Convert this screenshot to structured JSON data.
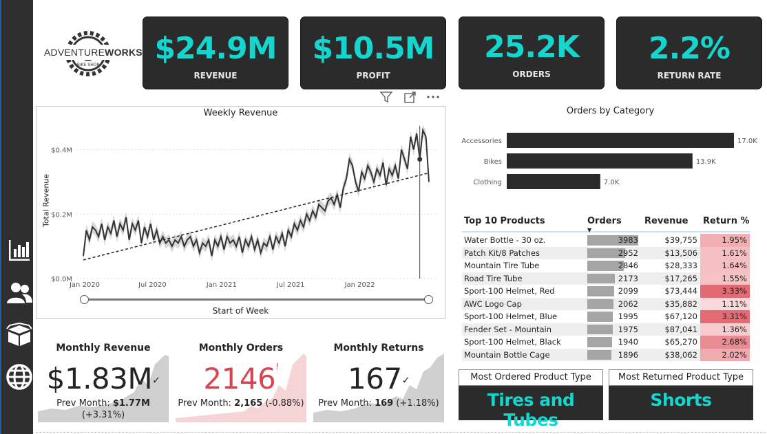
{
  "brand": {
    "logo_part1": "ADVENTURE",
    "logo_part2": "WORKS",
    "logo_sub": "BIKE SHOP"
  },
  "kpis": [
    {
      "value": "$24.9M",
      "label": "REVENUE"
    },
    {
      "value": "$10.5M",
      "label": "PROFIT"
    },
    {
      "value": "25.2K",
      "label": "ORDERS"
    },
    {
      "value": "2.2%",
      "label": "RETURN RATE"
    }
  ],
  "sidebar": {
    "icons": [
      "bar-chart-icon",
      "users-icon",
      "box-icon",
      "globe-icon"
    ]
  },
  "weekly_revenue": {
    "title": "Weekly Revenue",
    "xlabel": "Start of Week",
    "ylabel": "Total Revenue",
    "y_ticks": [
      "$0.0M",
      "$0.2M",
      "$0.4M"
    ],
    "x_ticks": [
      "Jan 2020",
      "Jul 2020",
      "Jan 2021",
      "Jul 2021",
      "Jan 2022"
    ]
  },
  "orders_by_category": {
    "title": "Orders by Category"
  },
  "top10": {
    "headers": {
      "product": "Top 10 Products",
      "orders": "Orders",
      "revenue": "Revenue",
      "return": "Return %"
    },
    "rows": [
      {
        "name": "Water Bottle - 30 oz.",
        "orders": "3983",
        "revenue": "$39,755",
        "return": "1.95%",
        "orders_val": 3983,
        "return_val": 1.95
      },
      {
        "name": "Patch Kit/8 Patches",
        "orders": "2952",
        "revenue": "$13,506",
        "return": "1.61%",
        "orders_val": 2952,
        "return_val": 1.61
      },
      {
        "name": "Mountain Tire Tube",
        "orders": "2846",
        "revenue": "$28,333",
        "return": "1.64%",
        "orders_val": 2846,
        "return_val": 1.64
      },
      {
        "name": "Road Tire Tube",
        "orders": "2173",
        "revenue": "$17,265",
        "return": "1.55%",
        "orders_val": 2173,
        "return_val": 1.55
      },
      {
        "name": "Sport-100 Helmet, Red",
        "orders": "2099",
        "revenue": "$73,444",
        "return": "3.33%",
        "orders_val": 2099,
        "return_val": 3.33
      },
      {
        "name": "AWC Logo Cap",
        "orders": "2062",
        "revenue": "$35,882",
        "return": "1.11%",
        "orders_val": 2062,
        "return_val": 1.11
      },
      {
        "name": "Sport-100 Helmet, Blue",
        "orders": "1995",
        "revenue": "$67,120",
        "return": "3.31%",
        "orders_val": 1995,
        "return_val": 3.31
      },
      {
        "name": "Fender Set - Mountain",
        "orders": "1975",
        "revenue": "$87,041",
        "return": "1.36%",
        "orders_val": 1975,
        "return_val": 1.36
      },
      {
        "name": "Sport-100 Helmet, Black",
        "orders": "1940",
        "revenue": "$65,270",
        "return": "2.68%",
        "orders_val": 1940,
        "return_val": 2.68
      },
      {
        "name": "Mountain Bottle Cage",
        "orders": "1896",
        "revenue": "$38,062",
        "return": "2.02%",
        "orders_val": 1896,
        "return_val": 2.02
      }
    ]
  },
  "product_types": [
    {
      "label": "Most Ordered Product Type",
      "value": "Tires and Tubes"
    },
    {
      "label": "Most Returned Product Type",
      "value": "Shorts"
    }
  ],
  "monthly": [
    {
      "title": "Monthly Revenue",
      "value": "$1.83M",
      "indicator": "✓",
      "prev_label": "Prev Month: ",
      "prev_value": "$1.77M",
      "prev_change": "(+3.31%)"
    },
    {
      "title": "Monthly Orders",
      "value": "2146",
      "indicator": "!",
      "prev_label": "Prev Month: ",
      "prev_value": "2,165",
      "prev_change": "(-0.88%)"
    },
    {
      "title": "Monthly Returns",
      "value": "167",
      "indicator": "✓",
      "prev_label": "Prev Month: ",
      "prev_value": "169",
      "prev_change": "(+1.18%)"
    }
  ],
  "colors": {
    "accent": "#14d6cf",
    "card_bg": "#2b2b2b",
    "bar": "#2b2b2b",
    "negative": "#d64550"
  },
  "chart_data": [
    {
      "type": "line",
      "title": "Weekly Revenue",
      "xlabel": "Start of Week",
      "ylabel": "Total Revenue",
      "ylim": [
        0,
        0.48
      ],
      "x_range": [
        "2020-01",
        "2022-06"
      ],
      "trendline": true,
      "series": [
        {
          "values": [
            0.07,
            0.15,
            0.12,
            0.16,
            0.15,
            0.13,
            0.17,
            0.12,
            0.16,
            0.14,
            0.18,
            0.13,
            0.17,
            0.15,
            0.19,
            0.12,
            0.17,
            0.15,
            0.18,
            0.11,
            0.16,
            0.13,
            0.17,
            0.12,
            0.15,
            0.11,
            0.13,
            0.11,
            0.12,
            0.1,
            0.12,
            0.11,
            0.13,
            0.1,
            0.12,
            0.13,
            0.1,
            0.12,
            0.08,
            0.11,
            0.1,
            0.12,
            0.07,
            0.12,
            0.1,
            0.13,
            0.09,
            0.13,
            0.11,
            0.12,
            0.1,
            0.13,
            0.08,
            0.12,
            0.1,
            0.13,
            0.09,
            0.12,
            0.08,
            0.11,
            0.1,
            0.13,
            0.09,
            0.13,
            0.11,
            0.14,
            0.1,
            0.15,
            0.13,
            0.17,
            0.15,
            0.18,
            0.16,
            0.2,
            0.18,
            0.21,
            0.19,
            0.23,
            0.22,
            0.21,
            0.24,
            0.25,
            0.23,
            0.26,
            0.22,
            0.28,
            0.31,
            0.37,
            0.35,
            0.3,
            0.27,
            0.33,
            0.31,
            0.35,
            0.33,
            0.3,
            0.34,
            0.32,
            0.36,
            0.29,
            0.34,
            0.32,
            0.35,
            0.31,
            0.4,
            0.37,
            0.34,
            0.44,
            0.4,
            0.45,
            0.37,
            0.46,
            0.44,
            0.3
          ]
        }
      ]
    },
    {
      "type": "bar",
      "title": "Orders by Category",
      "orientation": "horizontal",
      "categories": [
        "Accessories",
        "Bikes",
        "Clothing"
      ],
      "values": [
        17.0,
        13.9,
        7.0
      ],
      "value_labels": [
        "17.0K",
        "13.9K",
        "7.0K"
      ]
    }
  ]
}
